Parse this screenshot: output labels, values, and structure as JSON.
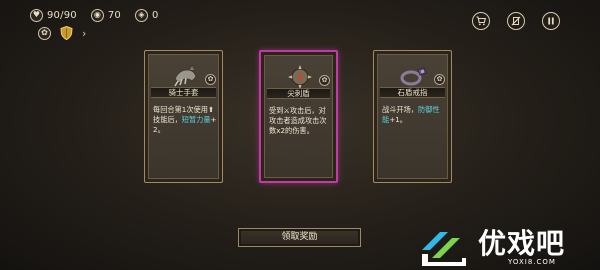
{
  "hud": {
    "health": {
      "icon": "heart-icon",
      "value": "90/90"
    },
    "gold": {
      "icon": "coin-icon",
      "value": "70"
    },
    "currency": {
      "icon": "rune-icon",
      "value": "0"
    },
    "relic_icons": [
      "gear-token-icon",
      "shield-icon",
      "chevron-right-icon"
    ],
    "chevron": "›"
  },
  "top_buttons": [
    "cart-icon",
    "no-deck-icon",
    "pause-icon"
  ],
  "rewards": [
    {
      "name": "骑士手套",
      "art": "gauntlet-icon",
      "desc_parts": [
        {
          "t": "每回合第1次使用",
          "hl": false
        },
        {
          "t": "⬆",
          "hl": false,
          "icon": "up-arrow-icon"
        },
        {
          "t": "技能后，",
          "hl": false
        },
        {
          "t": "短暂力量",
          "hl": true
        },
        {
          "t": "+2。",
          "hl": false
        }
      ]
    },
    {
      "name": "尖刺盾",
      "art": "spiked-shield-icon",
      "desc_parts": [
        {
          "t": "受到",
          "hl": false
        },
        {
          "t": "⚔",
          "hl": false,
          "icon": "sword-icon"
        },
        {
          "t": "攻击后，对攻击者造成攻击次数x2的伤害。",
          "hl": false
        }
      ]
    },
    {
      "name": "石盾戒指",
      "art": "ring-icon",
      "desc_parts": [
        {
          "t": "战斗开场，",
          "hl": false
        },
        {
          "t": "防御性能",
          "hl": true
        },
        {
          "t": "+1。",
          "hl": false
        }
      ]
    }
  ],
  "claim_button": "领取奖励",
  "watermark": {
    "text": "优戏吧",
    "url": "YOXI8.COM"
  },
  "colors": {
    "highlight": "#5fd3dd",
    "selected_border": "#c33aa6",
    "card_border": "#a48a5a"
  }
}
